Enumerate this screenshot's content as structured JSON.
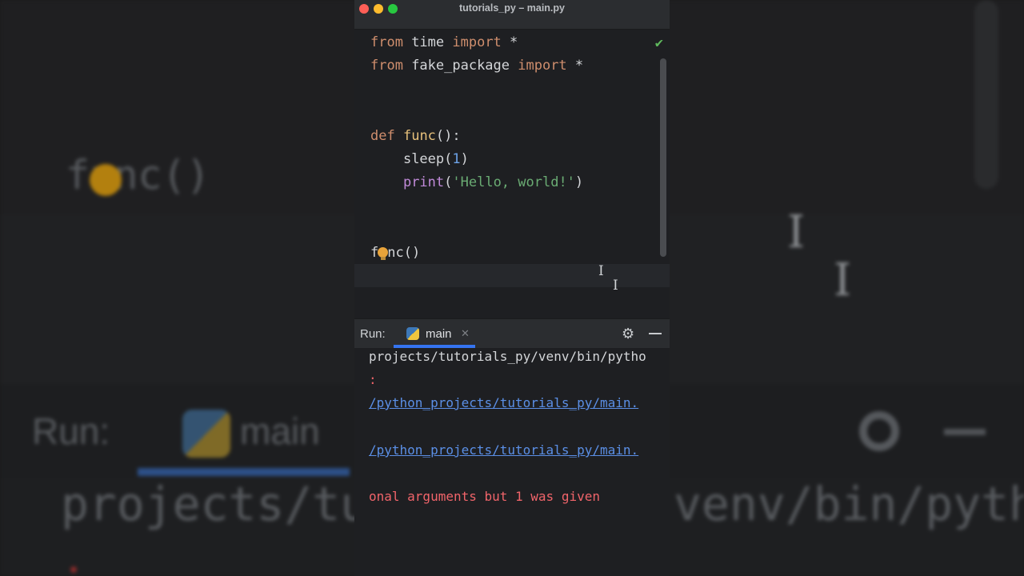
{
  "window": {
    "title": "tutorials_py – main.py"
  },
  "editor": {
    "lines": [
      {
        "t1": "from",
        "t2": " time ",
        "t3": "import",
        "t4": " *"
      },
      {
        "t1": "from",
        "t2": " fake_package ",
        "t3": "import",
        "t4": " *"
      },
      {
        "def": "def",
        "fname": "func",
        "rest": "():"
      },
      {
        "indent": "    ",
        "call": "sleep(",
        "num": "1",
        "close": ")"
      },
      {
        "indent": "    ",
        "builtin": "print",
        "open": "(",
        "str": "'Hello, world!'",
        "close": ")"
      },
      {
        "a": "f",
        "b": "nc()"
      }
    ],
    "status_icon": "checkmark-icon"
  },
  "background": {
    "code": "func()",
    "run_label": "Run:",
    "tab": "main",
    "path_left": "projects/tu",
    "path_right": "venv/bin/pytho"
  },
  "run_panel": {
    "label": "Run:",
    "tab": {
      "name": "main",
      "close": "✕"
    },
    "icons": [
      "gear-icon",
      "minimize-icon"
    ]
  },
  "console": {
    "lines": [
      {
        "text": "projects/tutorials_py/venv/bin/pytho",
        "kind": "plain"
      },
      {
        "text": ":",
        "kind": "err"
      },
      {
        "text": "/python_projects/tutorials_py/main.",
        "kind": "link"
      },
      {
        "text": "/python_projects/tutorials_py/main.",
        "kind": "link"
      },
      {
        "text": "onal arguments but 1 was given",
        "kind": "err"
      }
    ]
  },
  "colors": {
    "keyword": "#cf8e6d",
    "function": "#e6c07b",
    "string": "#6aab73",
    "number": "#6da3e8",
    "link": "#5b8fe6",
    "error": "#f0646a",
    "accent": "#3574f0"
  }
}
